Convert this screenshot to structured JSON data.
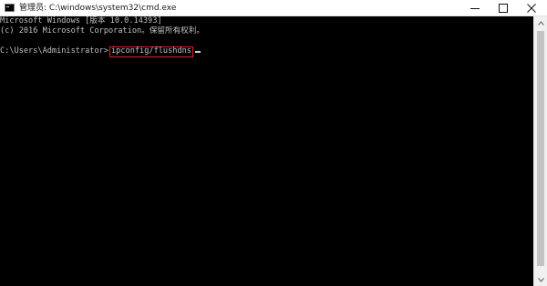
{
  "window": {
    "title": "管理员: C:\\windows\\system32\\cmd.exe"
  },
  "console": {
    "lines": [
      "Microsoft Windows [版本 10.0.14393]",
      "(c) 2016 Microsoft Corporation。保留所有权利。",
      ""
    ],
    "prompt": "C:\\Users\\Administrator>",
    "command": "ipconfig/flushdns"
  },
  "colors": {
    "console_bg": "#000000",
    "console_text": "#c0c0c0",
    "highlight_border": "#e81b23",
    "titlebar_bg": "#ffffff"
  },
  "icons": {
    "app": "cmd-console-icon",
    "minimize": "minimize-icon",
    "maximize": "maximize-icon",
    "close": "close-icon",
    "scroll_up": "scroll-up-arrow-icon",
    "scroll_down": "scroll-down-arrow-icon"
  }
}
